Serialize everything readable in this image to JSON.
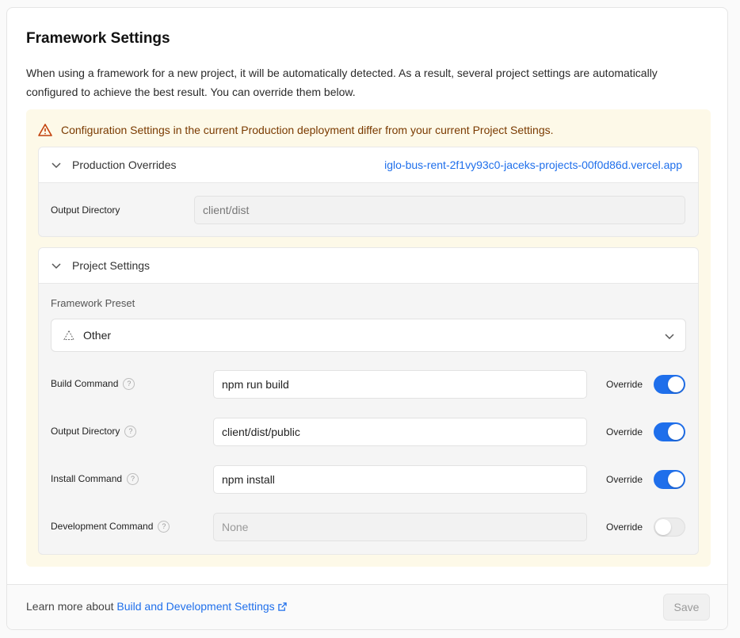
{
  "header": {
    "title": "Framework Settings",
    "description": "When using a framework for a new project, it will be automatically detected. As a result, several project settings are automatically configured to achieve the best result. You can override them below."
  },
  "warning": {
    "text": "Configuration Settings in the current Production deployment differ from your current Project Settings.",
    "icon": "warning-triangle-icon",
    "color": "#7a3a00",
    "background": "#fdf9e8"
  },
  "production_overrides": {
    "title": "Production Overrides",
    "deployment_link": "iglo-bus-rent-2f1vy93c0-jaceks-projects-00f0d86d.vercel.app",
    "output_directory_label": "Output Directory",
    "output_directory_value": "client/dist"
  },
  "project_settings": {
    "title": "Project Settings",
    "framework_preset_label": "Framework Preset",
    "framework_preset_value": "Other",
    "override_label": "Override",
    "rows": {
      "build": {
        "label": "Build Command",
        "value": "npm run build",
        "placeholder": "",
        "override": true
      },
      "output": {
        "label": "Output Directory",
        "value": "client/dist/public",
        "placeholder": "",
        "override": true
      },
      "install": {
        "label": "Install Command",
        "value": "npm install",
        "placeholder": "",
        "override": true
      },
      "development": {
        "label": "Development Command",
        "value": "",
        "placeholder": "None",
        "override": false
      }
    }
  },
  "footer": {
    "text": "Learn more about ",
    "link": "Build and Development Settings",
    "save_label": "Save"
  },
  "colors": {
    "accent": "#1f6feb"
  }
}
